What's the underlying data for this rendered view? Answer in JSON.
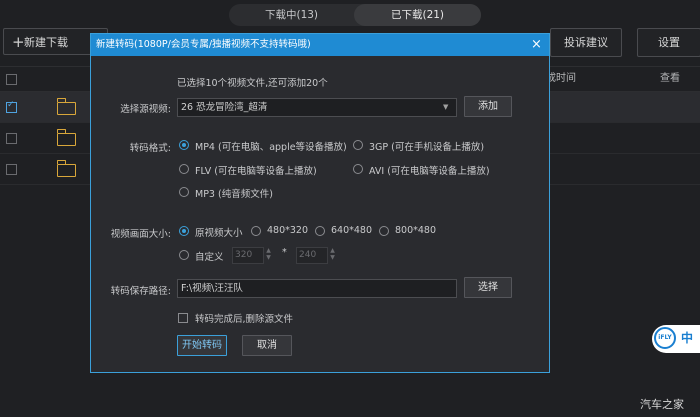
{
  "tabs": {
    "downloading": "下载中(13)",
    "downloaded": "已下载(21)"
  },
  "toolbar": {
    "new_download": "新建下载",
    "complain": "投诉建议",
    "settings": "设置"
  },
  "list": {
    "col_finish_time": "完成时间",
    "col_view": "查看"
  },
  "dialog": {
    "title": "新建转码(1080P/会员专属/独播视频不支持转码哦)",
    "close": "×",
    "selected_info": "已选择10个视频文件,还可添加20个",
    "source_label": "选择源视频:",
    "source_value": "26 恐龙冒险湾_超清",
    "add_button": "添加",
    "format_label": "转码格式:",
    "formats": {
      "mp4": "MP4 (可在电脑、apple等设备播放)",
      "3gp": "3GP (可在手机设备上播放)",
      "flv": "FLV (可在电脑等设备上播放)",
      "avi": "AVI (可在电脑等设备上播放)",
      "mp3": "MP3 (纯音频文件)"
    },
    "size_label": "视频画面大小:",
    "sizes": {
      "original": "原视频大小",
      "s480": "480*320",
      "s640": "640*480",
      "s800": "800*480",
      "custom": "自定义"
    },
    "custom_width": "320",
    "custom_sep": "*",
    "custom_height": "240",
    "path_label": "转码保存路径:",
    "path_value": "F:\\视频\\汪汪队",
    "choose_button": "选择",
    "delete_checkbox": "转码完成后,删除源文件",
    "start_button": "开始转码",
    "cancel_button": "取消"
  },
  "badge": {
    "ifly": "iFLY",
    "lang": "中"
  },
  "watermark": "汽车之家"
}
